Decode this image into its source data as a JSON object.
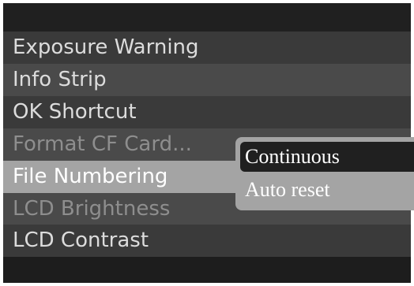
{
  "menu": {
    "items": [
      {
        "label": "Exposure Warning",
        "state": "normal"
      },
      {
        "label": "Info Strip",
        "state": "normal"
      },
      {
        "label": "OK Shortcut",
        "state": "normal"
      },
      {
        "label": "Format CF Card...",
        "state": "disabled"
      },
      {
        "label": "File Numbering",
        "state": "selected"
      },
      {
        "label": "LCD Brightness",
        "state": "disabled"
      },
      {
        "label": "LCD Contrast",
        "state": "normal"
      }
    ]
  },
  "submenu": {
    "options": [
      {
        "label": "Continuous",
        "active": true
      },
      {
        "label": "Auto reset",
        "active": false
      }
    ]
  },
  "colors": {
    "selected_row": "#a4a4a4",
    "active_option": "#202020",
    "disabled_text": "#8e8e8e"
  }
}
